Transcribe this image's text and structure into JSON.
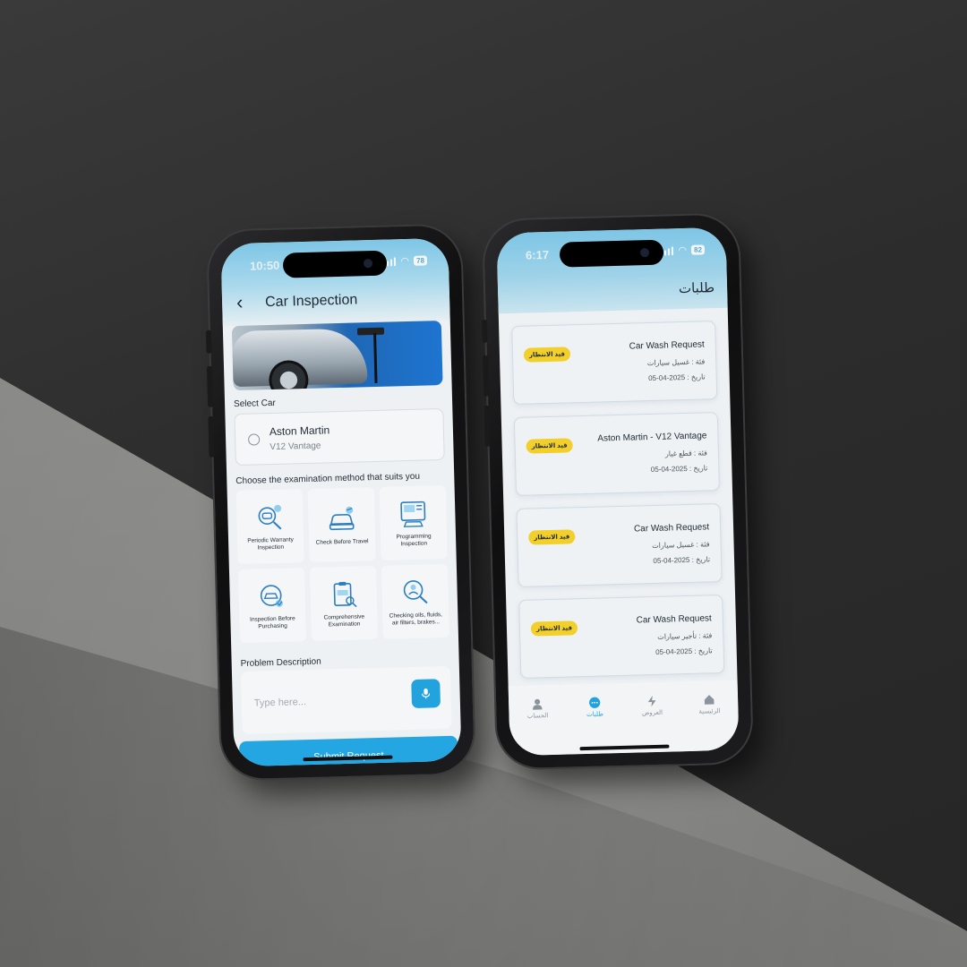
{
  "colors": {
    "accent": "#24a6e2",
    "badge": "#f2cf2a",
    "header_gradient": "#7ec6e6"
  },
  "phone1": {
    "status": {
      "time": "10:50",
      "battery": "78"
    },
    "header": {
      "title": "Car Inspection",
      "back_icon": "chevron-left-icon"
    },
    "select_car": {
      "label": "Select Car",
      "car": {
        "name": "Aston Martin",
        "model": "V12 Vantage"
      }
    },
    "methods": {
      "label": "Choose the examination method that suits you",
      "items": [
        {
          "label": "Periodic Warranty Inspection",
          "icon": "warranty-inspection-icon"
        },
        {
          "label": "Check Before Travel",
          "icon": "travel-check-icon"
        },
        {
          "label": "Programming Inspection",
          "icon": "programming-inspection-icon"
        },
        {
          "label": "Inspection Before Purchasing",
          "icon": "purchase-inspection-icon"
        },
        {
          "label": "Comprehensive Examination",
          "icon": "comprehensive-exam-icon"
        },
        {
          "label": "Checking oils, fluids, air filters, brakes...",
          "icon": "fluids-check-icon"
        }
      ]
    },
    "description": {
      "label": "Problem Description",
      "placeholder": "Type here..."
    },
    "submit_label": "Submit Request"
  },
  "phone2": {
    "status": {
      "time": "6:17",
      "battery": "82"
    },
    "header": {
      "title": "طلبات"
    },
    "requests": [
      {
        "title": "Car Wash Request",
        "category": "فئة : غسيل سيارات",
        "date": "تاريخ : 2025-04-05",
        "status": "قيد الانتظار"
      },
      {
        "title": "Aston Martin - V12 Vantage",
        "category": "فئة : قطع غيار",
        "date": "تاريخ : 2025-04-05",
        "status": "قيد الانتظار"
      },
      {
        "title": "Car Wash Request",
        "category": "فئة : غسيل سيارات",
        "date": "تاريخ : 2025-04-05",
        "status": "قيد الانتظار"
      },
      {
        "title": "Car Wash Request",
        "category": "فئة : تأجير سيارات",
        "date": "تاريخ : 2025-04-05",
        "status": "قيد الانتظار"
      }
    ],
    "nav": [
      {
        "label": "الرئيسية",
        "icon": "home-icon",
        "active": false
      },
      {
        "label": "العروض",
        "icon": "lightning-icon",
        "active": false
      },
      {
        "label": "طلبات",
        "icon": "chat-icon",
        "active": true
      },
      {
        "label": "الحساب",
        "icon": "user-icon",
        "active": false
      }
    ]
  }
}
